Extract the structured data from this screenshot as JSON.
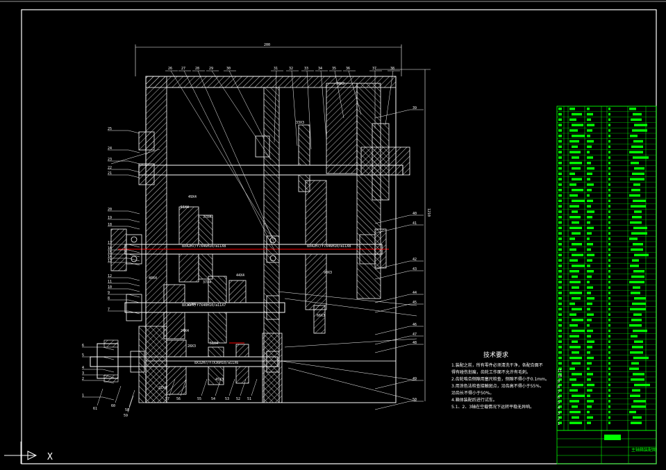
{
  "drawing": {
    "background": "#000000",
    "frame_color": "#ffffff",
    "leader_color": "#ffffff",
    "part_color": "#ffffff",
    "hatch_color": "#ffffff",
    "table_color": "#00ff00",
    "center_line_color": "#ff0000",
    "top_dimension": "200",
    "side_dimension": "1210",
    "part_numbers_top": [
      "26",
      "27",
      "28",
      "29",
      "30",
      "31",
      "32",
      "33",
      "34",
      "35",
      "36",
      "37",
      "38"
    ],
    "part_numbers_left": [
      "25",
      "24",
      "23",
      "22",
      "21",
      "20",
      "19",
      "18",
      "17",
      "16",
      "15",
      "14",
      "13",
      "12",
      "11",
      "10",
      "9",
      "8",
      "7",
      "6",
      "5",
      "4",
      "3",
      "2",
      "1"
    ],
    "part_numbers_right": [
      "39",
      "40",
      "41",
      "42",
      "43",
      "44",
      "45",
      "46",
      "47",
      "48",
      "49",
      "50"
    ],
    "part_numbers_bottom": [
      "61",
      "60",
      "59",
      "58",
      "57",
      "56",
      "55",
      "54",
      "53",
      "52",
      "51"
    ],
    "shaft_labels": [
      "8X42H7/f7X46H10/a11X8",
      "8X42H7/f7X46H10/a11X8",
      "8X36H7/f7X40H10/a11X7",
      "8X32H7/f7X36H10/a11X6"
    ],
    "gear_labels": [
      "78X3",
      "33X3",
      "51X4",
      "37X4",
      "40X4",
      "37X4",
      "44X4",
      "27X4",
      "24X4",
      "22X4",
      "45X3",
      "28X3",
      "90X3",
      "66X3",
      "49X4",
      "51X4"
    ],
    "bom_row_numbers": [
      "11",
      "10",
      "9",
      "8",
      "7",
      "6",
      "5",
      "4",
      "3",
      "2",
      "1"
    ],
    "title_block_text": "主轴箱装配图",
    "title_block_mark": "装配图",
    "ucs_axis_label": "X"
  },
  "technical_requirements": {
    "title": "技术要求",
    "lines": [
      "1.装配之前，所有零件必须清洗干净，各配合面不",
      "得有碰伤划痕，齿轮工作面不允许有毛刺。",
      "2.齿轮啮合侧隙用塞尺检查，侧隙不得小于0.1mm。",
      "3.用涂色法检查接触斑点，沿齿高不得小于55%，",
      "沿齿长不得小于50%。",
      "4.箱体装配后进行试车。",
      "5.1、2、3轴在空载情况下运转平稳无异响。"
    ]
  }
}
